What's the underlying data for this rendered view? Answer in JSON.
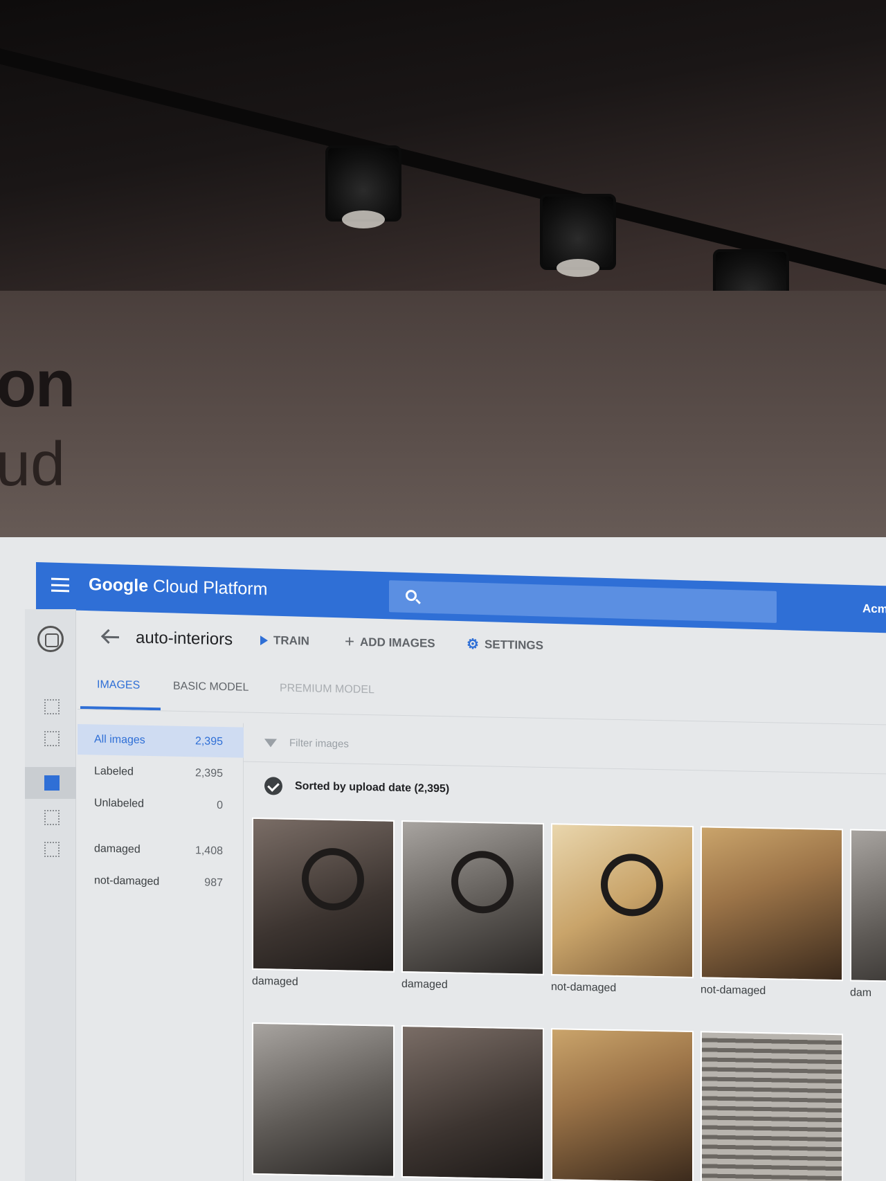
{
  "slide": {
    "title_fragment": "on",
    "subtitle_fragment": "ud"
  },
  "header": {
    "brand_bold": "Google",
    "brand_rest": " Cloud Platform",
    "account": "Acm",
    "search_placeholder": ""
  },
  "toolbar": {
    "dataset_name": "auto-interiors",
    "train_label": "TRAIN",
    "add_images_label": "ADD IMAGES",
    "settings_label": "SETTINGS"
  },
  "tabs": [
    {
      "label": "IMAGES",
      "state": "active"
    },
    {
      "label": "BASIC MODEL",
      "state": "enabled"
    },
    {
      "label": "PREMIUM MODEL",
      "state": "disabled"
    }
  ],
  "facets": [
    {
      "label": "All images",
      "count": "2,395"
    },
    {
      "label": "Labeled",
      "count": "2,395"
    },
    {
      "label": "Unlabeled",
      "count": "0"
    },
    {
      "label": "damaged",
      "count": "1,408"
    },
    {
      "label": "not-damaged",
      "count": "987"
    }
  ],
  "filter": {
    "placeholder": "Filter images"
  },
  "sort": {
    "label": "Sorted by upload date (2,395)"
  },
  "images": [
    {
      "label": "damaged",
      "icon": "steering-wheel"
    },
    {
      "label": "damaged",
      "icon": "steering-wheel"
    },
    {
      "label": "not-damaged",
      "icon": "steering-wheel"
    },
    {
      "label": "not-damaged",
      "icon": "gear-shift"
    },
    {
      "label": "dam",
      "icon": "partial"
    },
    {
      "label": "",
      "icon": "door-handle"
    },
    {
      "label": "",
      "icon": "center-console"
    },
    {
      "label": "",
      "icon": "seat"
    },
    {
      "label": "",
      "icon": "dashboard"
    }
  ],
  "colors": {
    "brand_blue": "#2f6fd6",
    "selected_facet_bg": "#cfdcf2"
  }
}
